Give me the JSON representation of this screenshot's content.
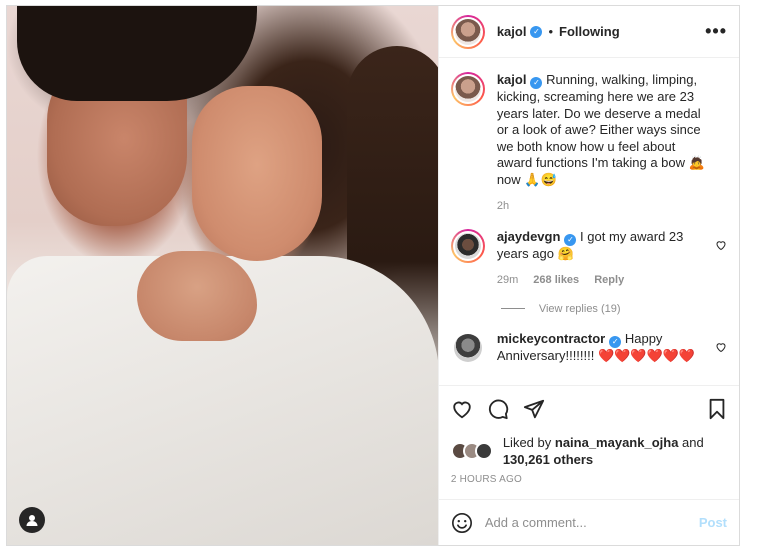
{
  "post": {
    "author": "kajol",
    "follow_status": "Following",
    "dot": "•",
    "more": "•••"
  },
  "caption": {
    "username": "kajol",
    "text": "Running, walking, limping, kicking, screaming here we are 23 years later. Do we deserve a medal or a look of awe? Either ways since we both know how u feel about award functions I'm taking a bow 🙇 now 🙏😅",
    "time": "2h"
  },
  "comments": [
    {
      "username": "ajaydevgn",
      "text": "I got my award 23 years ago 🤗",
      "time": "29m",
      "likes": "268 likes",
      "reply": "Reply",
      "view_replies": "View replies (19)"
    },
    {
      "username": "mickeycontractor",
      "text": "Happy Anniversary!!!!!!!! ❤️❤️❤️❤️❤️❤️"
    }
  ],
  "likes": {
    "prefix": "Liked by ",
    "user": "naina_mayank_ojha",
    "and": " and",
    "others": "130,261 others"
  },
  "timestamp": "2 HOURS AGO",
  "add_comment": {
    "placeholder": "Add a comment...",
    "post_label": "Post"
  },
  "colors": {
    "verified": "#3897f0",
    "post_disabled": "#b2dffc"
  }
}
